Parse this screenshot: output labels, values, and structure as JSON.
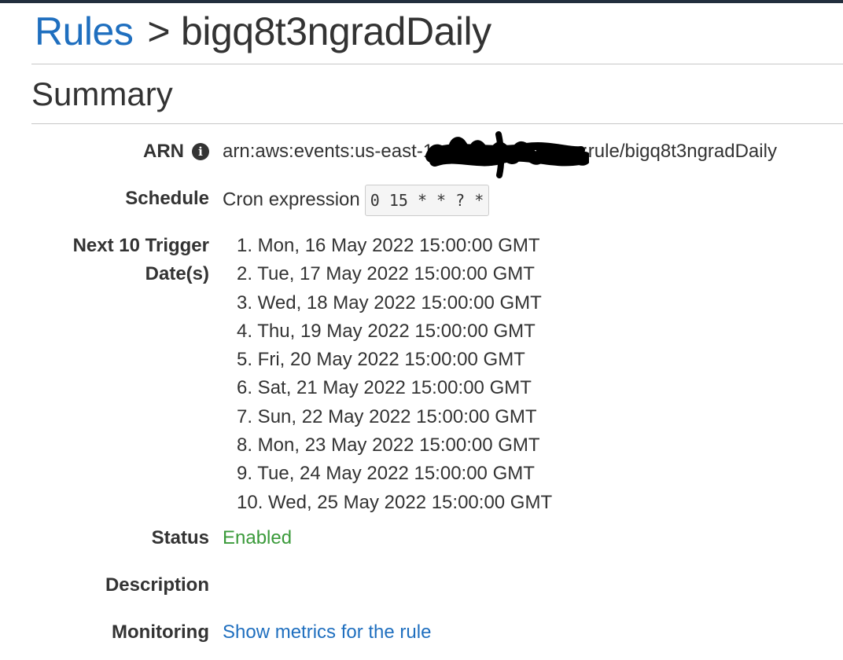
{
  "header": {
    "breadcrumb_link": "Rules",
    "separator": ">",
    "rule_name": "bigq8t3ngradDaily"
  },
  "summary": {
    "title": "Summary",
    "arn": {
      "label": "ARN",
      "info_icon": "info-icon",
      "value_prefix": "arn:aws:events:us-east-1",
      "value_suffix": ":rule/bigq8t3ngradDaily"
    },
    "schedule": {
      "label": "Schedule",
      "type_text": "Cron expression",
      "cron": "0 15 * * ? *"
    },
    "next_triggers": {
      "label_line1": "Next 10 Trigger",
      "label_line2": "Date(s)",
      "dates": [
        "1. Mon, 16 May 2022 15:00:00 GMT",
        "2. Tue, 17 May 2022 15:00:00 GMT",
        "3. Wed, 18 May 2022 15:00:00 GMT",
        "4. Thu, 19 May 2022 15:00:00 GMT",
        "5. Fri, 20 May 2022 15:00:00 GMT",
        "6. Sat, 21 May 2022 15:00:00 GMT",
        "7. Sun, 22 May 2022 15:00:00 GMT",
        "8. Mon, 23 May 2022 15:00:00 GMT",
        "9. Tue, 24 May 2022 15:00:00 GMT",
        "10. Wed, 25 May 2022 15:00:00 GMT"
      ]
    },
    "status": {
      "label": "Status",
      "value": "Enabled"
    },
    "description": {
      "label": "Description",
      "value": ""
    },
    "monitoring": {
      "label": "Monitoring",
      "link_text": "Show metrics for the rule"
    }
  },
  "colors": {
    "link": "#1f6fbf",
    "status_enabled": "#3a9a3a",
    "text": "#333333",
    "top_bar": "#232f3e"
  }
}
